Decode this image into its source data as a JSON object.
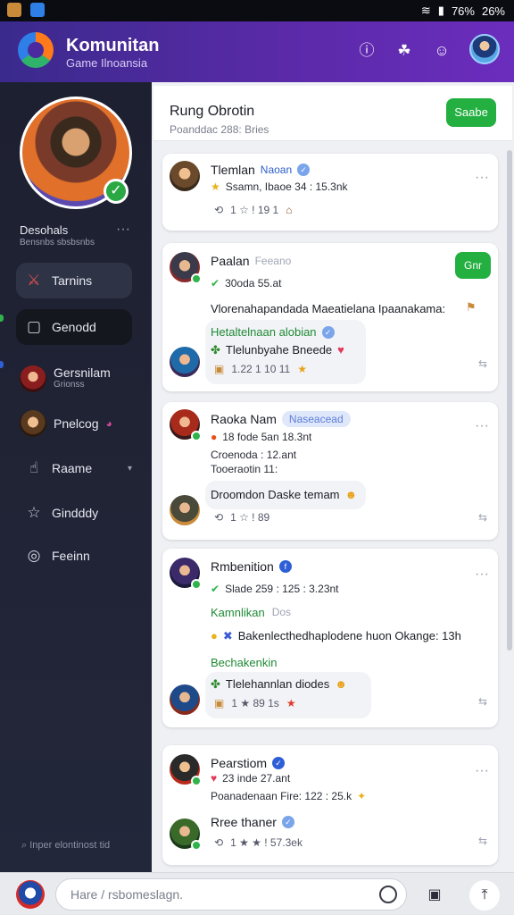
{
  "statusbar": {
    "battery": "76%",
    "signal_text": "26%"
  },
  "header": {
    "title": "Komunitan",
    "subtitle": "Game Ilnoansia"
  },
  "sidebar": {
    "profile_name": "Desohals",
    "profile_sub": "Bensnbs sbsbsnbs",
    "nav": [
      {
        "label": "Tarnins"
      },
      {
        "label": "Genodd"
      }
    ],
    "friends": [
      {
        "name": "Gersnilam",
        "sub": "Grionss"
      },
      {
        "name": "Pnelcog"
      }
    ],
    "links": [
      {
        "label": "Raame"
      },
      {
        "label": "Gindddy"
      },
      {
        "label": "Feeinn"
      }
    ],
    "footer": "Inper elontinost tid"
  },
  "main": {
    "title": "Rung Obrotin",
    "subtitle": "Poanddac 288: Bries",
    "save_label": "Saabe"
  },
  "posts": [
    {
      "name": "Tlemlan",
      "tag": "Naoan",
      "meta": "Ssamn, Ibaoe 34 : 15.3nk",
      "reacts": "1  ☆  !  19  1"
    },
    {
      "name": "Paalan",
      "tag": "Feeano",
      "join_label": "Gnr",
      "meta": "30oda 55.at",
      "body": "Vlorenahapandada Maeatielana Ipaanakama:",
      "green": "Hetaltelnaan alobian",
      "reply": "Tlelunbyahe Bneede",
      "reacts": "1.22  1  10  11"
    },
    {
      "name": "Raoka Nam",
      "tag": "Naseacead",
      "meta": "18 fode 5an 18.3nt",
      "line2": "Croenoda : 12.ant",
      "line3": "Tooeraotin 11:",
      "reply": "Droomdon Daske temam",
      "reacts": "1  ☆  !  89"
    },
    {
      "name": "Rmbenition",
      "meta": "Slade 259 : 125 : 3.23nt",
      "green": "Kamnlikan",
      "gray_tag": "Dos",
      "body": "Bakenlecthedhaplodene huon Okange: 13h",
      "green2": "Bechakenkin",
      "reply": "Tlelehannlan diodes",
      "reacts": "1  ★  89  1s"
    },
    {
      "name": "Pearstiom",
      "meta": "23 inde 27.ant",
      "line2": "Poanadenaan Fire: 122 : 25.k",
      "reply_name": "Rree thaner",
      "reacts": "1  ★  ★  !  57.3ek"
    }
  ],
  "composer": {
    "placeholder": "Hare / rsbomeslagn."
  }
}
